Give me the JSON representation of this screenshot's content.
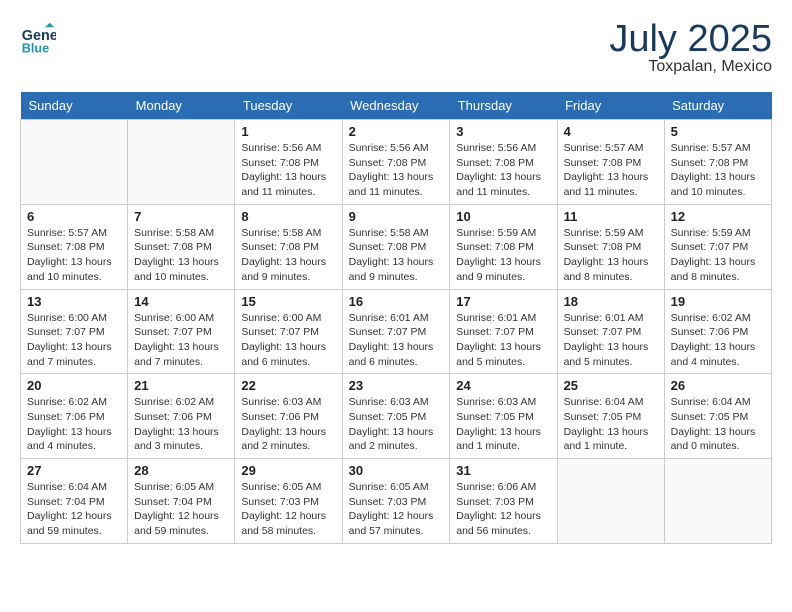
{
  "header": {
    "logo_line1": "General",
    "logo_line2": "Blue",
    "month": "July 2025",
    "location": "Toxpalan, Mexico"
  },
  "days_of_week": [
    "Sunday",
    "Monday",
    "Tuesday",
    "Wednesday",
    "Thursday",
    "Friday",
    "Saturday"
  ],
  "weeks": [
    [
      {
        "day": "",
        "info": ""
      },
      {
        "day": "",
        "info": ""
      },
      {
        "day": "1",
        "info": "Sunrise: 5:56 AM\nSunset: 7:08 PM\nDaylight: 13 hours and 11 minutes."
      },
      {
        "day": "2",
        "info": "Sunrise: 5:56 AM\nSunset: 7:08 PM\nDaylight: 13 hours and 11 minutes."
      },
      {
        "day": "3",
        "info": "Sunrise: 5:56 AM\nSunset: 7:08 PM\nDaylight: 13 hours and 11 minutes."
      },
      {
        "day": "4",
        "info": "Sunrise: 5:57 AM\nSunset: 7:08 PM\nDaylight: 13 hours and 11 minutes."
      },
      {
        "day": "5",
        "info": "Sunrise: 5:57 AM\nSunset: 7:08 PM\nDaylight: 13 hours and 10 minutes."
      }
    ],
    [
      {
        "day": "6",
        "info": "Sunrise: 5:57 AM\nSunset: 7:08 PM\nDaylight: 13 hours and 10 minutes."
      },
      {
        "day": "7",
        "info": "Sunrise: 5:58 AM\nSunset: 7:08 PM\nDaylight: 13 hours and 10 minutes."
      },
      {
        "day": "8",
        "info": "Sunrise: 5:58 AM\nSunset: 7:08 PM\nDaylight: 13 hours and 9 minutes."
      },
      {
        "day": "9",
        "info": "Sunrise: 5:58 AM\nSunset: 7:08 PM\nDaylight: 13 hours and 9 minutes."
      },
      {
        "day": "10",
        "info": "Sunrise: 5:59 AM\nSunset: 7:08 PM\nDaylight: 13 hours and 9 minutes."
      },
      {
        "day": "11",
        "info": "Sunrise: 5:59 AM\nSunset: 7:08 PM\nDaylight: 13 hours and 8 minutes."
      },
      {
        "day": "12",
        "info": "Sunrise: 5:59 AM\nSunset: 7:07 PM\nDaylight: 13 hours and 8 minutes."
      }
    ],
    [
      {
        "day": "13",
        "info": "Sunrise: 6:00 AM\nSunset: 7:07 PM\nDaylight: 13 hours and 7 minutes."
      },
      {
        "day": "14",
        "info": "Sunrise: 6:00 AM\nSunset: 7:07 PM\nDaylight: 13 hours and 7 minutes."
      },
      {
        "day": "15",
        "info": "Sunrise: 6:00 AM\nSunset: 7:07 PM\nDaylight: 13 hours and 6 minutes."
      },
      {
        "day": "16",
        "info": "Sunrise: 6:01 AM\nSunset: 7:07 PM\nDaylight: 13 hours and 6 minutes."
      },
      {
        "day": "17",
        "info": "Sunrise: 6:01 AM\nSunset: 7:07 PM\nDaylight: 13 hours and 5 minutes."
      },
      {
        "day": "18",
        "info": "Sunrise: 6:01 AM\nSunset: 7:07 PM\nDaylight: 13 hours and 5 minutes."
      },
      {
        "day": "19",
        "info": "Sunrise: 6:02 AM\nSunset: 7:06 PM\nDaylight: 13 hours and 4 minutes."
      }
    ],
    [
      {
        "day": "20",
        "info": "Sunrise: 6:02 AM\nSunset: 7:06 PM\nDaylight: 13 hours and 4 minutes."
      },
      {
        "day": "21",
        "info": "Sunrise: 6:02 AM\nSunset: 7:06 PM\nDaylight: 13 hours and 3 minutes."
      },
      {
        "day": "22",
        "info": "Sunrise: 6:03 AM\nSunset: 7:06 PM\nDaylight: 13 hours and 2 minutes."
      },
      {
        "day": "23",
        "info": "Sunrise: 6:03 AM\nSunset: 7:05 PM\nDaylight: 13 hours and 2 minutes."
      },
      {
        "day": "24",
        "info": "Sunrise: 6:03 AM\nSunset: 7:05 PM\nDaylight: 13 hours and 1 minute."
      },
      {
        "day": "25",
        "info": "Sunrise: 6:04 AM\nSunset: 7:05 PM\nDaylight: 13 hours and 1 minute."
      },
      {
        "day": "26",
        "info": "Sunrise: 6:04 AM\nSunset: 7:05 PM\nDaylight: 13 hours and 0 minutes."
      }
    ],
    [
      {
        "day": "27",
        "info": "Sunrise: 6:04 AM\nSunset: 7:04 PM\nDaylight: 12 hours and 59 minutes."
      },
      {
        "day": "28",
        "info": "Sunrise: 6:05 AM\nSunset: 7:04 PM\nDaylight: 12 hours and 59 minutes."
      },
      {
        "day": "29",
        "info": "Sunrise: 6:05 AM\nSunset: 7:03 PM\nDaylight: 12 hours and 58 minutes."
      },
      {
        "day": "30",
        "info": "Sunrise: 6:05 AM\nSunset: 7:03 PM\nDaylight: 12 hours and 57 minutes."
      },
      {
        "day": "31",
        "info": "Sunrise: 6:06 AM\nSunset: 7:03 PM\nDaylight: 12 hours and 56 minutes."
      },
      {
        "day": "",
        "info": ""
      },
      {
        "day": "",
        "info": ""
      }
    ]
  ]
}
